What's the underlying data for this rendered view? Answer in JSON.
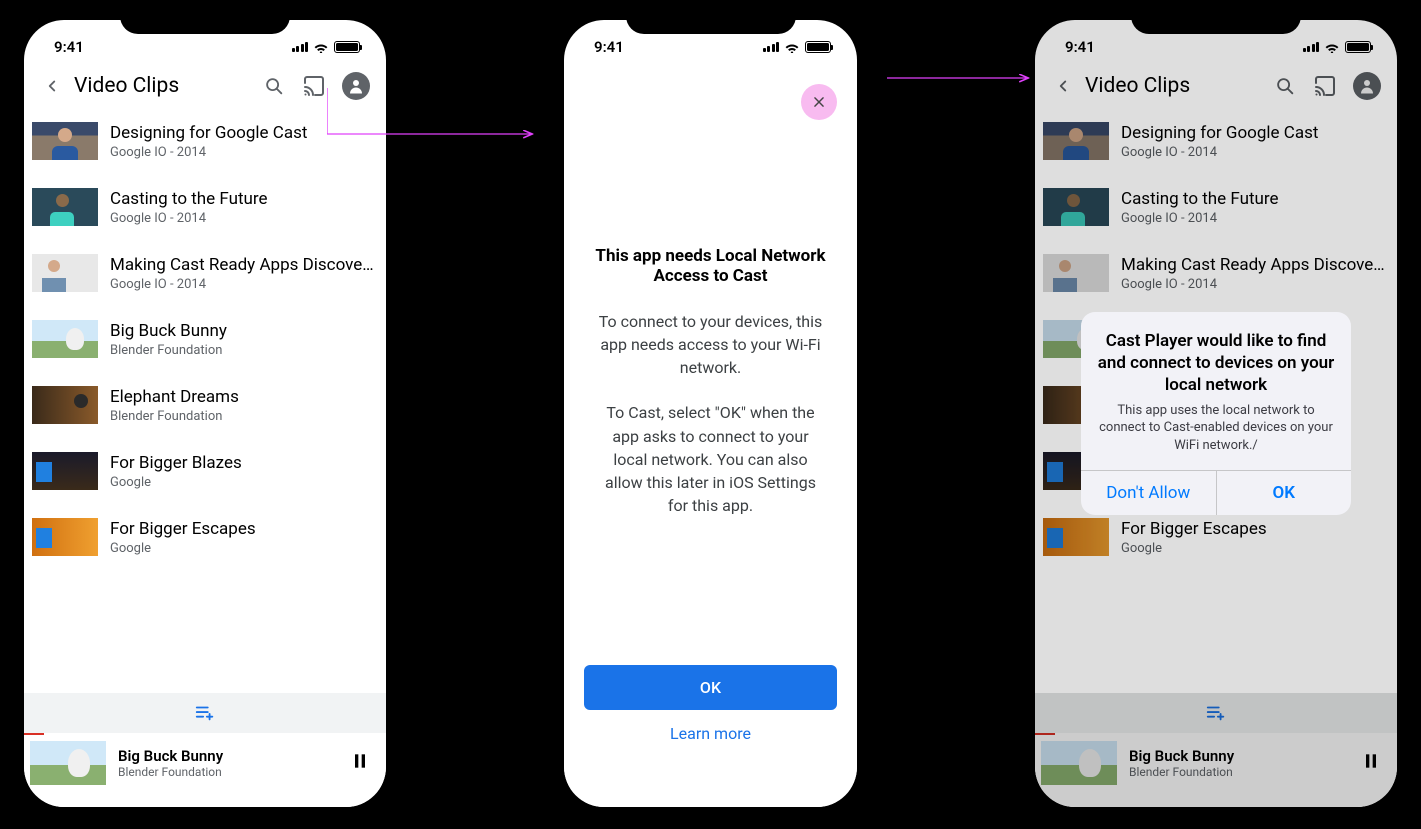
{
  "time": "9:41",
  "page_title": "Video Clips",
  "videos": [
    {
      "title": "Designing for Google Cast",
      "subtitle": "Google IO - 2014"
    },
    {
      "title": "Casting to the Future",
      "subtitle": "Google IO - 2014"
    },
    {
      "title": "Making Cast Ready Apps Discover...",
      "subtitle": "Google IO - 2014"
    },
    {
      "title": "Big Buck Bunny",
      "subtitle": "Blender Foundation"
    },
    {
      "title": "Elephant Dreams",
      "subtitle": "Blender Foundation"
    },
    {
      "title": "For Bigger Blazes",
      "subtitle": "Google"
    },
    {
      "title": "For Bigger Escapes",
      "subtitle": "Google"
    }
  ],
  "player": {
    "title": "Big Buck Bunny",
    "subtitle": "Blender Foundation"
  },
  "interstitial": {
    "title": "This app needs Local Network Access to Cast",
    "p1": "To connect to your devices, this app needs access to your Wi-Fi network.",
    "p2": "To Cast, select \"OK\" when the app asks to connect to your local network. You can also allow this later in iOS Settings for this app.",
    "ok": "OK",
    "learn": "Learn more"
  },
  "alert": {
    "title": "Cast Player would like to find and connect to devices on your local network",
    "message": "This app uses the local network to connect to Cast-enabled devices on your WiFi network./",
    "deny": "Don't Allow",
    "ok": "OK"
  }
}
